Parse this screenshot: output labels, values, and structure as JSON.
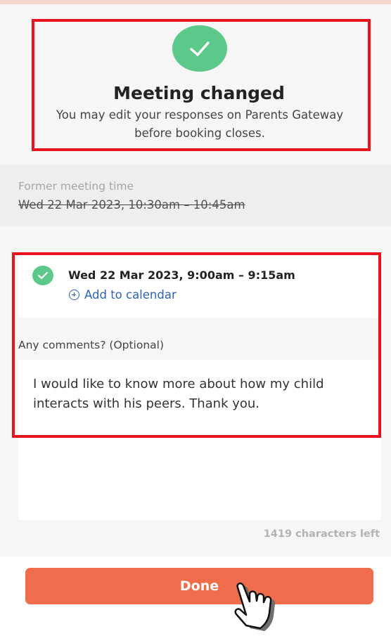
{
  "header": {
    "title": "Meeting changed",
    "subtitle": "You may edit your responses on Parents Gateway before booking closes.",
    "icon": "check-circle-icon"
  },
  "former_meeting": {
    "label": "Former meeting time",
    "value": "Wed 22 Mar 2023, 10:30am – 10:45am"
  },
  "new_meeting": {
    "time": "Wed 22 Mar 2023, 9:00am – 9:15am",
    "add_to_calendar": "Add to calendar"
  },
  "comments": {
    "label": "Any comments? (Optional)",
    "value": "I would like to know more about how my child interacts with his peers. Thank you.",
    "chars_left": "1419 characters left"
  },
  "actions": {
    "done_label": "Done"
  },
  "colors": {
    "accent_green": "#5cc98a",
    "button_orange": "#ef6d4b",
    "link_blue": "#2b63b8",
    "highlight_red": "#e8141d"
  }
}
